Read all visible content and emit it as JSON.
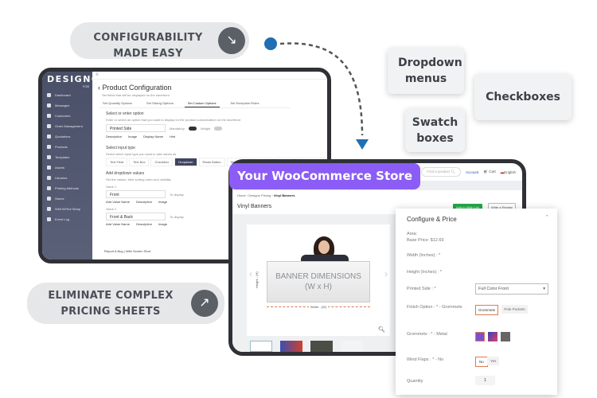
{
  "hero": {
    "configurability": "CONFIGURABILITY MADE EASY",
    "eliminate": "ELIMINATE COMPLEX PRICING SHEETS",
    "features": [
      "Dropdown menus",
      "Checkboxes",
      "Swatch boxes"
    ],
    "store_label": "Your WooCommerce Store",
    "accent": "#8b5cf6"
  },
  "admin": {
    "logo": "DESIGNO",
    "logo_sub": "FOB",
    "sidebar": [
      "Dashboard",
      "Messages",
      "Customers",
      "Order Management",
      "Quotations",
      "Products",
      "Templates",
      "Assets",
      "Libraries",
      "Printing Methods",
      "Stores",
      "WebToPrint Setup",
      "Event Log"
    ],
    "title": "Product Configuration",
    "subtitle": "Set fields that will be displayed on the storefront",
    "tabs": [
      "Set Quantity Options",
      "Set Slicing Options",
      "Set Custom Options",
      "Set Exception Rules"
    ],
    "select_option_heading": "Select or enter option",
    "select_option_help": "Enter or select an option that you want to display for the product customization on the storefront",
    "option_value": "Printed Side",
    "mandatory": "Mandatory",
    "weight": "Weight",
    "option_links": [
      "Description",
      "Image",
      "Display Name",
      "Hint"
    ],
    "input_type_heading": "Select input type",
    "input_type_help": "Select which input type you want to add values as",
    "input_types": [
      "Text Field",
      "Text Box",
      "Checkbox",
      "Dropdown",
      "Radio Button",
      "Hidden Field",
      "Swatch",
      "Attribute",
      "Image Dropdown"
    ],
    "dropdown_heading": "Add dropdown values",
    "dropdown_help": "Set the values, their sorting order and visibility",
    "values": [
      {
        "label": "Value 1",
        "value": "Front"
      },
      {
        "label": "Value 2",
        "value": "Front & Back"
      }
    ],
    "to_display": "To display",
    "value_links": [
      "Add Value Name",
      "Description",
      "Image"
    ],
    "add_new_value": "Add New Value",
    "footer": "Report A Bug | With Screen Shot"
  },
  "store": {
    "search_placeholder": "Find a product",
    "account": "Account",
    "cart": "Cart",
    "language": "English",
    "breadcrumb": [
      "Home",
      "Designo Pricing",
      "Vinyl Banners"
    ],
    "title": "Vinyl Banners",
    "wishlist": "Add to Wish List",
    "review": "Write a Review",
    "banner_line1": "BANNER DIMENSIONS",
    "banner_line2": "(W x H)",
    "width_label": "Width - (W)",
    "height_label": "Height - (H)"
  },
  "config": {
    "title": "Configure & Price",
    "area": "Area:",
    "base_price": "Base Price: $12.69",
    "width": "Width (Inches) : *",
    "height": "Height (Inches) : *",
    "printed_side": "Printed Side : *",
    "printed_side_value": "Full Color Front",
    "finish": "Finish Option : * - Grommets",
    "finish_options": [
      "Grommets",
      "Pole Pockets"
    ],
    "grommets": "Grommets : * - Metal",
    "wind": "Wind Flaps : * - No",
    "wind_options": [
      "No",
      "Yes"
    ],
    "quantity": "Quantity",
    "quantity_value": "1"
  }
}
